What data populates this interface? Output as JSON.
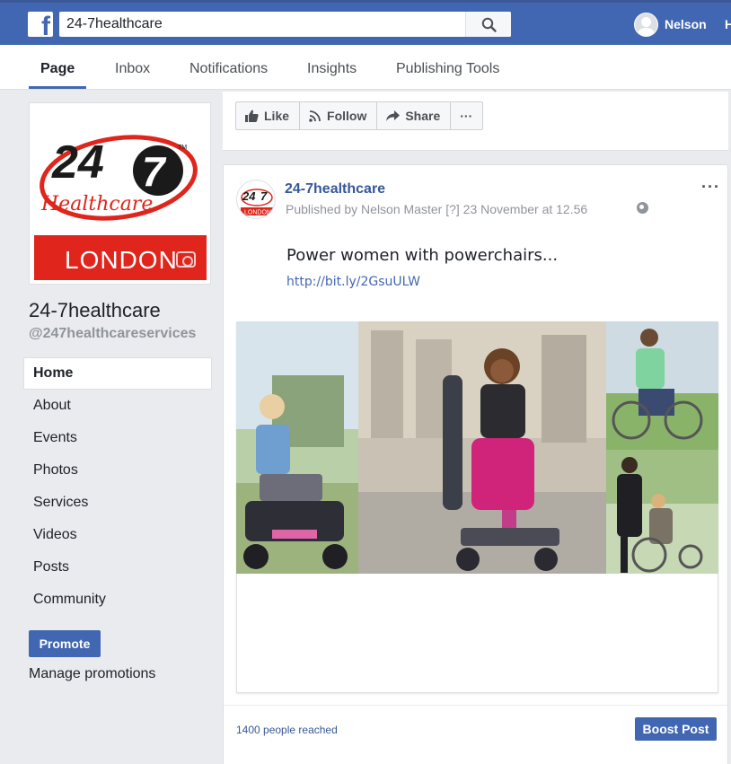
{
  "topbar": {
    "search_value": "24-7healthcare",
    "user_name": "Nelson",
    "home_label": "H"
  },
  "page_nav": {
    "tabs": [
      {
        "label": "Page",
        "active": true
      },
      {
        "label": "Inbox",
        "active": false
      },
      {
        "label": "Notifications",
        "active": false
      },
      {
        "label": "Insights",
        "active": false
      },
      {
        "label": "Publishing Tools",
        "active": false
      }
    ]
  },
  "profile": {
    "logo_247": "24",
    "logo_7": "7",
    "logo_tm": "TM",
    "logo_script": "Healthcare",
    "logo_city": "LONDON",
    "page_name": "24-7healthcare",
    "handle": "@247healthcareservices"
  },
  "sidebar": {
    "items": [
      {
        "label": "Home",
        "active": true
      },
      {
        "label": "About"
      },
      {
        "label": "Events"
      },
      {
        "label": "Photos"
      },
      {
        "label": "Services"
      },
      {
        "label": "Videos"
      },
      {
        "label": "Posts"
      },
      {
        "label": "Community"
      }
    ],
    "promote_label": "Promote",
    "manage_label": "Manage promotions"
  },
  "actions": {
    "like": "Like",
    "follow": "Follow",
    "share": "Share",
    "more": "···"
  },
  "post": {
    "author": "24-7healthcare",
    "meta": "Published by Nelson Master [?] 23 November at 12.56",
    "more": "···",
    "text": "Power women with powerchairs...",
    "link": "http://bit.ly/2GsuULW",
    "avatar_247": "24",
    "avatar_7": "7",
    "avatar_city": "LONDON",
    "reached": "1400 people reached",
    "boost_label": "Boost Post"
  },
  "colors": {
    "brand_blue": "#4267b2",
    "logo_red": "#e0251c",
    "link_blue": "#365899"
  }
}
